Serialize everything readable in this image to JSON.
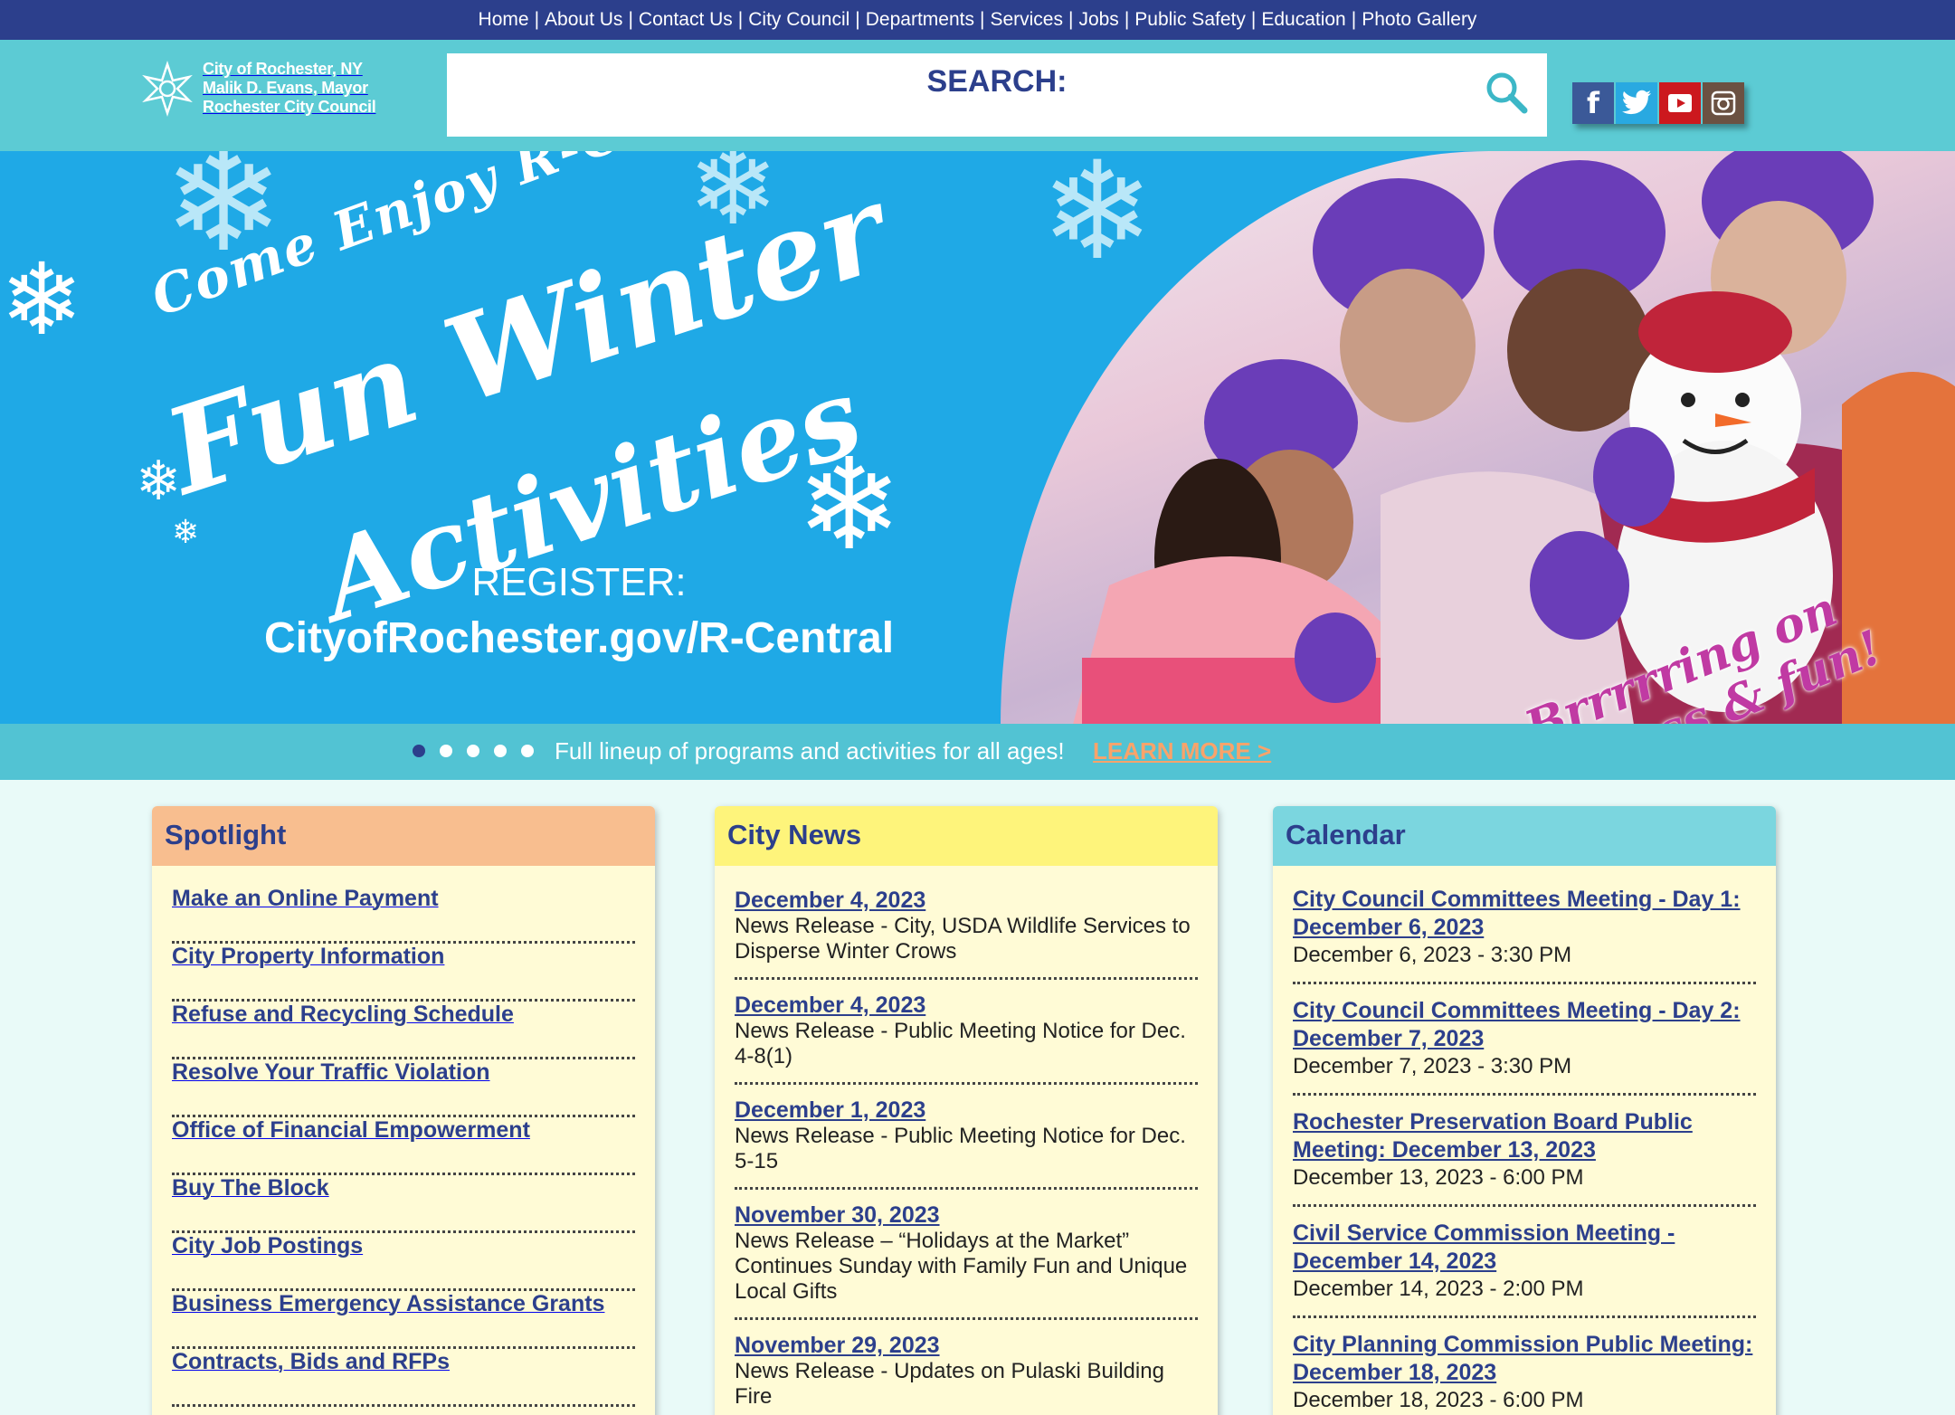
{
  "topnav": [
    "Home",
    "About Us",
    "Contact Us",
    "City Council",
    "Departments",
    "Services",
    "Jobs",
    "Public Safety",
    "Education",
    "Photo Gallery"
  ],
  "logo": {
    "line1": "City of Rochester, NY",
    "line2": "Malik D. Evans, Mayor",
    "line3": "Rochester City Council"
  },
  "search": {
    "label": "SEARCH:",
    "value": "",
    "icon": "search-icon"
  },
  "social": [
    "facebook-icon",
    "twitter-icon",
    "youtube-icon",
    "instagram-icon"
  ],
  "banner": {
    "line1": "Come Enjoy R-Center's",
    "line2": "Fun Winter",
    "line3": "Activities",
    "register": "REGISTER:",
    "url": "CityofRochester.gov/R-Central",
    "tagline1": "Brrrrring on",
    "tagline2": "fitness & fun!"
  },
  "slider": {
    "dot_count": 5,
    "active_index": 0,
    "caption": "Full lineup of programs and activities for all ages!",
    "link": "LEARN MORE >"
  },
  "colors": {
    "navy": "#2c3f8c",
    "teal": "#5ccbd4",
    "cream": "#fffbd6",
    "orange": "#f9a36a"
  },
  "spotlight": {
    "title": "Spotlight",
    "items": [
      "Make an Online Payment",
      "City Property Information",
      "Refuse and Recycling Schedule",
      "Resolve Your Traffic Violation",
      "Office of Financial Empowerment",
      "Buy The Block",
      "City Job Postings",
      "Business Emergency Assistance Grants",
      "Contracts, Bids and RFPs"
    ]
  },
  "news": {
    "title": "City News",
    "items": [
      {
        "date": "December 4, 2023",
        "text": "News Release - City, USDA Wildlife Services to Disperse Winter Crows"
      },
      {
        "date": "December 4, 2023",
        "text": "News Release - Public Meeting Notice for Dec. 4-8(1)"
      },
      {
        "date": "December 1, 2023",
        "text": "News Release - Public Meeting Notice for Dec. 5-15"
      },
      {
        "date": "November 30, 2023",
        "text": "News Release – “Holidays at the Market” Continues Sunday with Family Fun and Unique Local Gifts"
      },
      {
        "date": "November 29, 2023",
        "text": "News Release - Updates on Pulaski Building Fire"
      }
    ]
  },
  "calendar": {
    "title": "Calendar",
    "items": [
      {
        "title": "City Council Committees Meeting - Day 1: December 6, 2023",
        "time": "December 6, 2023 - 3:30 PM"
      },
      {
        "title": "City Council Committees Meeting - Day 2: December 7, 2023",
        "time": "December 7, 2023 - 3:30 PM"
      },
      {
        "title": "Rochester Preservation Board Public Meeting: December 13, 2023",
        "time": "December 13, 2023 - 6:00 PM"
      },
      {
        "title": "Civil Service Commission Meeting - December 14, 2023",
        "time": "December 14, 2023 - 2:00 PM"
      },
      {
        "title": "City Planning Commission Public Meeting: December 18, 2023",
        "time": "December 18, 2023 - 6:00 PM"
      }
    ]
  }
}
